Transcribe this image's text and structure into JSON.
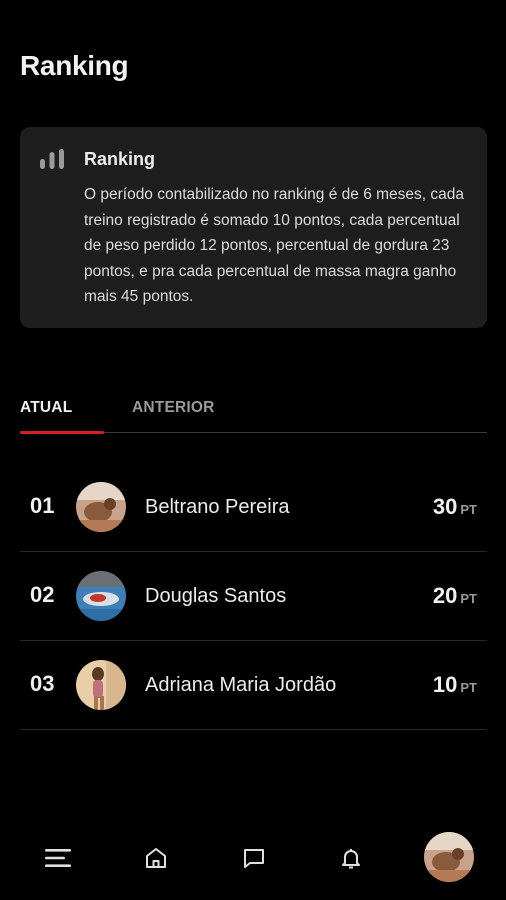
{
  "page": {
    "title": "Ranking"
  },
  "info_card": {
    "icon": "bar-chart-icon",
    "title": "Ranking",
    "text": "O período contabilizado no ranking é de 6 meses, cada treino registrado é somado 10 pontos, cada percentual de peso perdido 12 pontos, percentual de gordura 23 pontos, e pra cada percentual de massa magra ganho mais 45 pontos."
  },
  "tabs": [
    {
      "label": "ATUAL",
      "active": true
    },
    {
      "label": "ANTERIOR",
      "active": false
    }
  ],
  "ranking": [
    {
      "position": "01",
      "name": "Beltrano Pereira",
      "points": "30",
      "unit": "PT"
    },
    {
      "position": "02",
      "name": "Douglas Santos",
      "points": "20",
      "unit": "PT"
    },
    {
      "position": "03",
      "name": "Adriana Maria Jordão",
      "points": "10",
      "unit": "PT"
    }
  ],
  "bottom_nav": [
    {
      "icon": "menu-icon"
    },
    {
      "icon": "home-icon"
    },
    {
      "icon": "chat-icon"
    },
    {
      "icon": "bell-icon"
    },
    {
      "icon": "profile-avatar"
    }
  ],
  "colors": {
    "accent": "#d81f26",
    "background": "#000000",
    "card": "#1e1e1e"
  }
}
